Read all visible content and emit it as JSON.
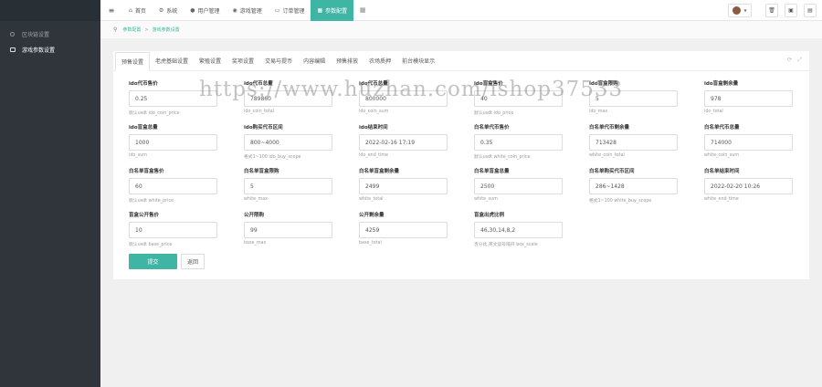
{
  "sidebar": {
    "items": [
      {
        "label": "区块链设置",
        "icon": "circle-icon",
        "active": false
      },
      {
        "label": "游戏参数设置",
        "icon": "monitor-icon",
        "active": true
      }
    ]
  },
  "topnav": {
    "items": [
      {
        "label": "首页",
        "icon": "home-icon",
        "glyph": "⌂"
      },
      {
        "label": "系统",
        "icon": "gear-icon",
        "glyph": "⚙"
      },
      {
        "label": "用户管理",
        "icon": "user-icon",
        "glyph": "👤"
      },
      {
        "label": "游戏管理",
        "icon": "gamepad-icon",
        "glyph": "◉"
      },
      {
        "label": "订单管理",
        "icon": "order-icon",
        "glyph": "▭"
      },
      {
        "label": "参数配置",
        "icon": "config-icon",
        "glyph": "▦",
        "active": true
      }
    ]
  },
  "breadcrumb": {
    "items": [
      "参数配置",
      "游戏参数设置"
    ]
  },
  "tabs": [
    "预售设置",
    "老虎基础设置",
    "繁殖设置",
    "奖项设置",
    "交易与提币",
    "内容编辑",
    "预售排放",
    "农场质押",
    "前台模块显示"
  ],
  "form": {
    "fields": [
      {
        "label": "ido代币售价",
        "value": "0.25",
        "hint": "默认usdt ido_coin_price"
      },
      {
        "label": "ido代币总量",
        "value": "789860",
        "hint": "ido_coin_total"
      },
      {
        "label": "ido代币总量",
        "value": "800000",
        "hint": "ido_coin_sum"
      },
      {
        "label": "ido盲盒售价",
        "value": "40",
        "hint": "默认usdt ido_price"
      },
      {
        "label": "ido盲盒限购",
        "value": "5",
        "hint": "ido_max"
      },
      {
        "label": "ido盲盒剩余量",
        "value": "978",
        "hint": "ido_total"
      },
      {
        "label": "ido盲盒总量",
        "value": "1000",
        "hint": "ido_sum"
      },
      {
        "label": "ido购买代币区间",
        "value": "800~4000",
        "hint": "格式1~100 ido_buy_scope"
      },
      {
        "label": "ido结束时间",
        "value": "2022-02-16 17:19",
        "hint": "ido_end_time"
      },
      {
        "label": "白名单代币售价",
        "value": "0.35",
        "hint": "默认usdt white_coin_price"
      },
      {
        "label": "白名单代币剩余量",
        "value": "713428",
        "hint": "white_coin_total"
      },
      {
        "label": "白名单代币总量",
        "value": "714000",
        "hint": "white_coin_sum"
      },
      {
        "label": "白名单盲盒售价",
        "value": "60",
        "hint": "默认usdt white_price"
      },
      {
        "label": "白名单盲盒限购",
        "value": "5",
        "hint": "white_max"
      },
      {
        "label": "白名单盲盒剩余量",
        "value": "2499",
        "hint": "white_total"
      },
      {
        "label": "白名单盲盒总量",
        "value": "2500",
        "hint": "white_sum"
      },
      {
        "label": "白名单购买代币区间",
        "value": "286~1428",
        "hint": "格式1~100 white_buy_scope"
      },
      {
        "label": "白名单结束时间",
        "value": "2022-02-20 10:26",
        "hint": "white_end_time"
      },
      {
        "label": "盲盒公开售价",
        "value": "10",
        "hint": "默认usdt base_price"
      },
      {
        "label": "公开限购",
        "value": "99",
        "hint": "base_max"
      },
      {
        "label": "公开剩余量",
        "value": "4259",
        "hint": "base_total"
      },
      {
        "label": "盲盒出虎比例",
        "value": "46,30,14,8,2",
        "hint": "百分比,英文逗号隔开 box_scale"
      }
    ],
    "submit_label": "提交",
    "back_label": "返回"
  },
  "watermark": "https://www.huzhan.com/ishop37533",
  "colors": {
    "accent": "#3fb5a4",
    "sidebar": "#2f353b"
  }
}
